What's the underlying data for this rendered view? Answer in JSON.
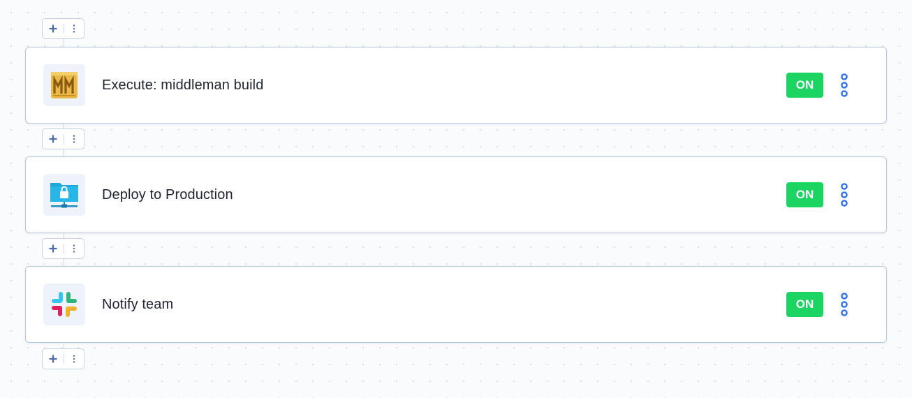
{
  "pipeline": {
    "steps": [
      {
        "title": "Execute: middleman build",
        "icon": "middleman-icon",
        "toggle_label": "ON"
      },
      {
        "title": "Deploy to Production",
        "icon": "secure-server-icon",
        "toggle_label": "ON"
      },
      {
        "title": "Notify team",
        "icon": "slack-icon",
        "toggle_label": "ON"
      }
    ]
  },
  "colors": {
    "toggle_on": "#1bd462",
    "menu_dots": "#2f6fe8",
    "card_border": "#b7c8e6",
    "accent_plus": "#4f6aa8"
  }
}
